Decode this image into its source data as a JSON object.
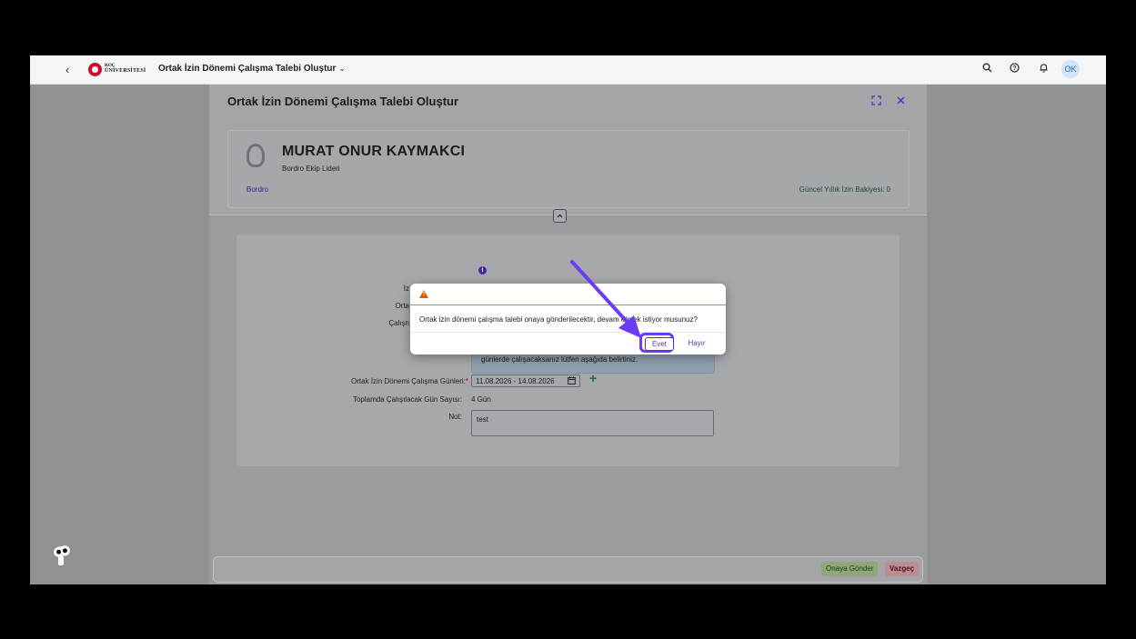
{
  "shell": {
    "back_glyph": "‹",
    "logo_line1": "KOÇ",
    "logo_line2": "ÜNİVERSİTESİ",
    "title": "Ortak İzin Dönemi Çalışma Talebi Oluştur",
    "chevron": "⌄",
    "avatar_initials": "OK"
  },
  "page": {
    "title": "Ortak İzin Dönemi Çalışma Talebi Oluştur",
    "employee_name": "MURAT ONUR KAYMAKCI",
    "employee_role": "Bordro Ekip Lideri",
    "department": "Bordro",
    "balance": "Güncel Yıllık İzin Bakiyesi: 0"
  },
  "form": {
    "label_izin_partial": "İz",
    "label_ortak_partial": "Orta",
    "label_calisma_partial": "Çalışn",
    "info_text": "günlerde çalışacaksanız lütfen aşağıda belirtiniz.",
    "days_label": "Ortak İzin Dönemi Çalışma Günleri:",
    "required_mark": "*",
    "days_value": "11.08.2026 - 14.08.2026",
    "total_label": "Toplamda Çalışılacak Gün Sayısı:",
    "total_value": "4 Gün",
    "note_label": "Not:",
    "note_value": "test"
  },
  "footer": {
    "approve_label": "Onaya Gönder",
    "cancel_label": "Vazgeç"
  },
  "dialog": {
    "message": "Ortak izin dönemi çalışma talebi onaya gönderilecektir, devam etmek istiyor musunuz?",
    "yes_label": "Evet",
    "no_label": "Hayır"
  },
  "colors": {
    "accent": "#5a2fc2",
    "highlight": "#6c3bf5",
    "warning": "#e35b00"
  }
}
